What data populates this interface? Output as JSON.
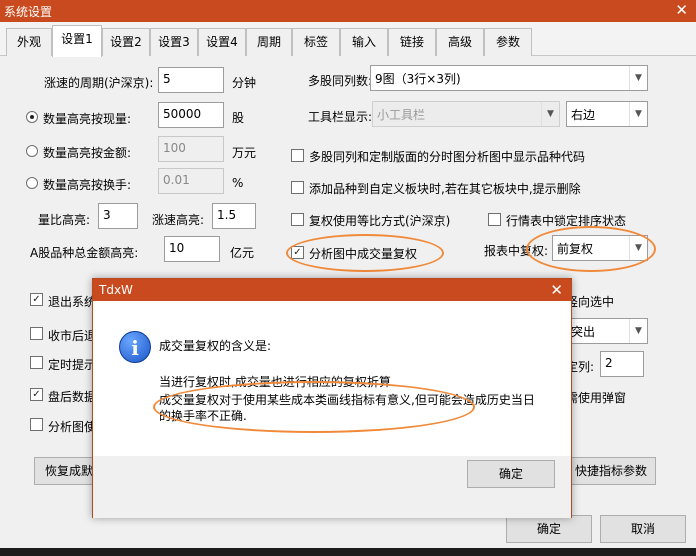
{
  "window": {
    "title": "系统设置",
    "close_glyph": "✕"
  },
  "tabs": [
    {
      "label": "外观"
    },
    {
      "label": "设置1"
    },
    {
      "label": "设置2"
    },
    {
      "label": "设置3"
    },
    {
      "label": "设置4"
    },
    {
      "label": "周期"
    },
    {
      "label": "标签"
    },
    {
      "label": "输入"
    },
    {
      "label": "链接"
    },
    {
      "label": "高级"
    },
    {
      "label": "参数"
    }
  ],
  "active_tab": "设置1",
  "left": {
    "speed_period_label": "涨速的周期(沪深京):",
    "speed_period_value": "5",
    "speed_period_unit": "分钟",
    "highlight_by": [
      {
        "label": "数量高亮按现量:",
        "value": "50000",
        "unit": "股",
        "selected": true
      },
      {
        "label": "数量高亮按金额:",
        "value": "100",
        "unit": "万元",
        "selected": false
      },
      {
        "label": "数量高亮按换手:",
        "value": "0.01",
        "unit": "%",
        "selected": false
      }
    ],
    "volume_ratio_label": "量比高亮:",
    "volume_ratio_value": "3",
    "speed_highlight_label": "涨速高亮:",
    "speed_highlight_value": "1.5",
    "a_share_total_label": "A股品种总金额高亮:",
    "a_share_total_value": "10",
    "a_share_total_unit": "亿元"
  },
  "right": {
    "multi_cols_label": "多股同列数:",
    "multi_cols_value": "9图（3行×3列)",
    "toolbar_label": "工具栏显示:",
    "toolbar_value": "小工具栏",
    "toolbar_pos_value": "右边",
    "opt_show_code": "多股同列和定制版面的分时图分析图中显示品种代码",
    "opt_add_block": "添加品种到自定义板块时,若在其它板块中,提示删除",
    "opt_equal_ratio": "复权使用等比方式(沪深京)",
    "opt_lock_sort": "行情表中锁定排序状态",
    "opt_volume_adjust": "分析图中成交量复权",
    "report_adjust_label": "报表中复权:",
    "report_adjust_value": "前复权"
  },
  "lower_left_partial": [
    {
      "label": "退出系统",
      "checked": true
    },
    {
      "label": "收市后退",
      "checked": false
    },
    {
      "label": "定时提示",
      "checked": false
    },
    {
      "label": "盘后数据",
      "checked": true
    },
    {
      "label": "分析图使",
      "checked": false
    }
  ],
  "lower_right_partial": {
    "vertical_select": "竖向选中",
    "exit_select_value": "突出",
    "col_label": "定列:",
    "col_value": "2",
    "popup_text": "需使用弹窗"
  },
  "restore_button": "恢复成默",
  "indicator_button": "快捷指标参数",
  "ok_button": "确定",
  "cancel_button": "取消",
  "dialog": {
    "title": "TdxW",
    "icon_glyph": "i",
    "heading": "成交量复权的含义是:",
    "line1": "当进行复权时,成交量也进行相应的复权折算.",
    "line2": "成交量复权对于使用某些成本类画线指标有意义,但可能会造成历史当日",
    "line3": "的换手率不正确.",
    "ok": "确定",
    "close_glyph": "✕"
  }
}
